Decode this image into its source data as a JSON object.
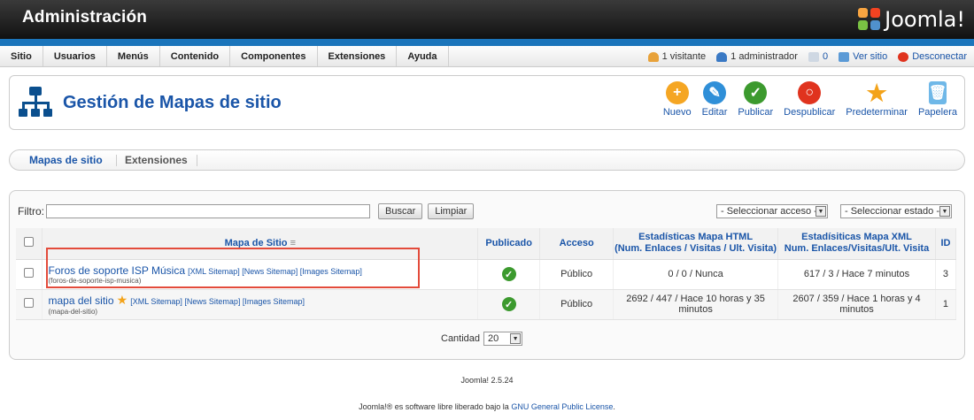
{
  "header": {
    "title": "Administración",
    "logo_text": "Joomla!"
  },
  "menu": [
    "Sitio",
    "Usuarios",
    "Menús",
    "Contenido",
    "Componentes",
    "Extensiones",
    "Ayuda"
  ],
  "status": {
    "visitors": "1 visitante",
    "admins": "1 administrador",
    "messages": "0",
    "view_site": "Ver sitio",
    "logout": "Desconectar"
  },
  "page": {
    "title": "Gestión de Mapas de sitio"
  },
  "toolbar": {
    "new": "Nuevo",
    "edit": "Editar",
    "publish": "Publicar",
    "unpublish": "Despublicar",
    "default": "Predeterminar",
    "trash": "Papelera"
  },
  "subnav": [
    "Mapas de sitio",
    "Extensiones"
  ],
  "filter": {
    "label": "Filtro:",
    "value": "",
    "search": "Buscar",
    "clear": "Limpiar",
    "access": "- Seleccionar acceso -",
    "state": "- Seleccionar estado -"
  },
  "table": {
    "headers": {
      "map": "Mapa de Sitio",
      "published": "Publicado",
      "access": "Acceso",
      "html_stats": "Estadísticas Mapa HTML",
      "html_stats_sub": "(Num. Enlaces / Visitas / Ult. Visita)",
      "xml_stats": "Estadísiticas Mapa XML",
      "xml_stats_sub": "Num. Enlaces/Visitas/Ult. Visita",
      "id": "ID"
    },
    "rows": [
      {
        "name": "Foros de soporte ISP Música",
        "links": "[XML Sitemap] [News Sitemap] [Images Sitemap]",
        "alias": "(foros-de-soporte-isp-musica)",
        "access": "Público",
        "html": "0 / 0 / Nunca",
        "xml": "617 / 3 / Hace 7 minutos",
        "id": "3"
      },
      {
        "name": "mapa del sitio",
        "links": "[XML Sitemap] [News Sitemap] [Images Sitemap]",
        "alias": "(mapa-del-sitio)",
        "access": "Público",
        "html": "2692 / 447 / Hace 10 horas y 35 minutos",
        "xml": "2607 / 359 / Hace 1 horas y 4 minutos",
        "id": "1"
      }
    ]
  },
  "pagination": {
    "label": "Cantidad",
    "value": "20"
  },
  "footer": {
    "version": "Joomla! 2.5.24",
    "license_pre": "Joomla!® es software libre liberado bajo la",
    "license_link": "GNU General Public License",
    "license_post": "."
  }
}
